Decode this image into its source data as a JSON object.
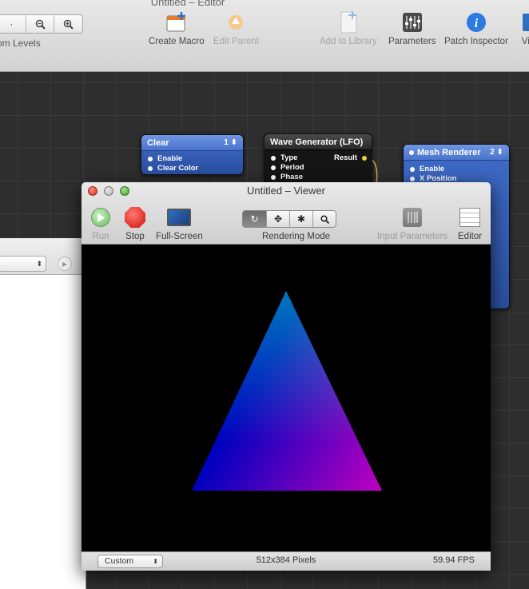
{
  "editor": {
    "title": "Untitled – Editor",
    "zoom_label": "om Levels",
    "toolbar": {
      "create_macro": "Create Macro",
      "edit_parent": "Edit Parent",
      "add_to_library": "Add to Library",
      "parameters": "Parameters",
      "patch_inspector": "Patch Inspector",
      "viewer_partial": "Vie"
    }
  },
  "patches": {
    "clear": {
      "title": "Clear",
      "badge": "1 ⬍",
      "inputs": [
        "Enable",
        "Clear Color"
      ]
    },
    "wave": {
      "title": "Wave Generator (LFO)",
      "inputs": [
        "Type",
        "Period",
        "Phase"
      ],
      "output": "Result"
    },
    "mesh": {
      "title": "Mesh Renderer",
      "badge": "2 ⬍",
      "inputs": [
        "Enable",
        "X Position"
      ]
    }
  },
  "viewer": {
    "title": "Untitled – Viewer",
    "run": "Run",
    "stop": "Stop",
    "fullscreen": "Full-Screen",
    "rendering_mode": "Rendering Mode",
    "input_parameters": "Input Parameters",
    "editor": "Editor",
    "resolution_preset": "Custom",
    "pixels": "512x384 Pixels",
    "fps": "59.94 FPS"
  },
  "colors": {
    "patch_blue": "#3f6cc8",
    "triangle_top": "#00a000",
    "triangle_left": "#0000ff",
    "triangle_right": "#ff0000"
  }
}
